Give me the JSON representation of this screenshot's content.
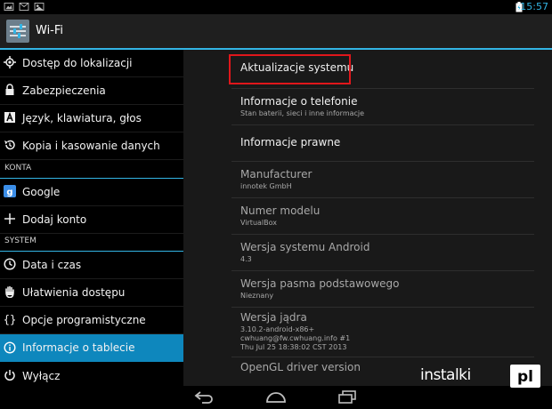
{
  "status_bar": {
    "time": "15:57"
  },
  "action_bar": {
    "title": "Wi-Fi"
  },
  "left_menu": {
    "items": [
      {
        "label": "Dostęp do lokalizacji",
        "icon": "location-icon"
      },
      {
        "label": "Zabezpieczenia",
        "icon": "lock-icon"
      },
      {
        "label": "Język, klawiatura, głos",
        "icon": "keyboard-a-icon"
      },
      {
        "label": "Kopia i kasowanie danych",
        "icon": "restore-icon"
      },
      {
        "label": "Google",
        "icon": "google-icon"
      },
      {
        "label": "Dodaj konto",
        "icon": "plus-icon"
      },
      {
        "label": "Data i czas",
        "icon": "clock-icon"
      },
      {
        "label": "Ułatwienia dostępu",
        "icon": "hand-icon"
      },
      {
        "label": "Opcje programistyczne",
        "icon": "braces-icon"
      },
      {
        "label": "Informacje o tablecie",
        "icon": "info-icon",
        "active": true
      },
      {
        "label": "Wyłącz",
        "icon": "power-icon"
      }
    ],
    "sections": {
      "accounts": "KONTA",
      "system": "SYSTEM"
    }
  },
  "about": {
    "items": [
      {
        "title": "Aktualizacje systemu"
      },
      {
        "title": "Informacje o telefonie",
        "summary": "Stan baterii, sieci i inne informacje"
      },
      {
        "title": "Informacje prawne"
      },
      {
        "title": "Manufacturer",
        "summary": "innotek GmbH"
      },
      {
        "title": "Numer modelu",
        "summary": "VirtualBox"
      },
      {
        "title": "Wersja systemu Android",
        "summary": "4.3"
      },
      {
        "title": "Wersja pasma podstawowego",
        "summary": "Nieznany"
      },
      {
        "title": "Wersja jądra",
        "summary_lines": [
          "3.10.2-android-x86+",
          "cwhuang@fw.cwhuang.info #1",
          "Thu Jul 25 18:38:02 CST 2013"
        ]
      },
      {
        "title": "OpenGL driver version"
      }
    ]
  },
  "watermark": {
    "text": "instalki",
    "logo": "pl"
  },
  "colors": {
    "accent": "#33b5e5",
    "active_item": "#0e87bd",
    "highlight_box": "#e0161b"
  }
}
